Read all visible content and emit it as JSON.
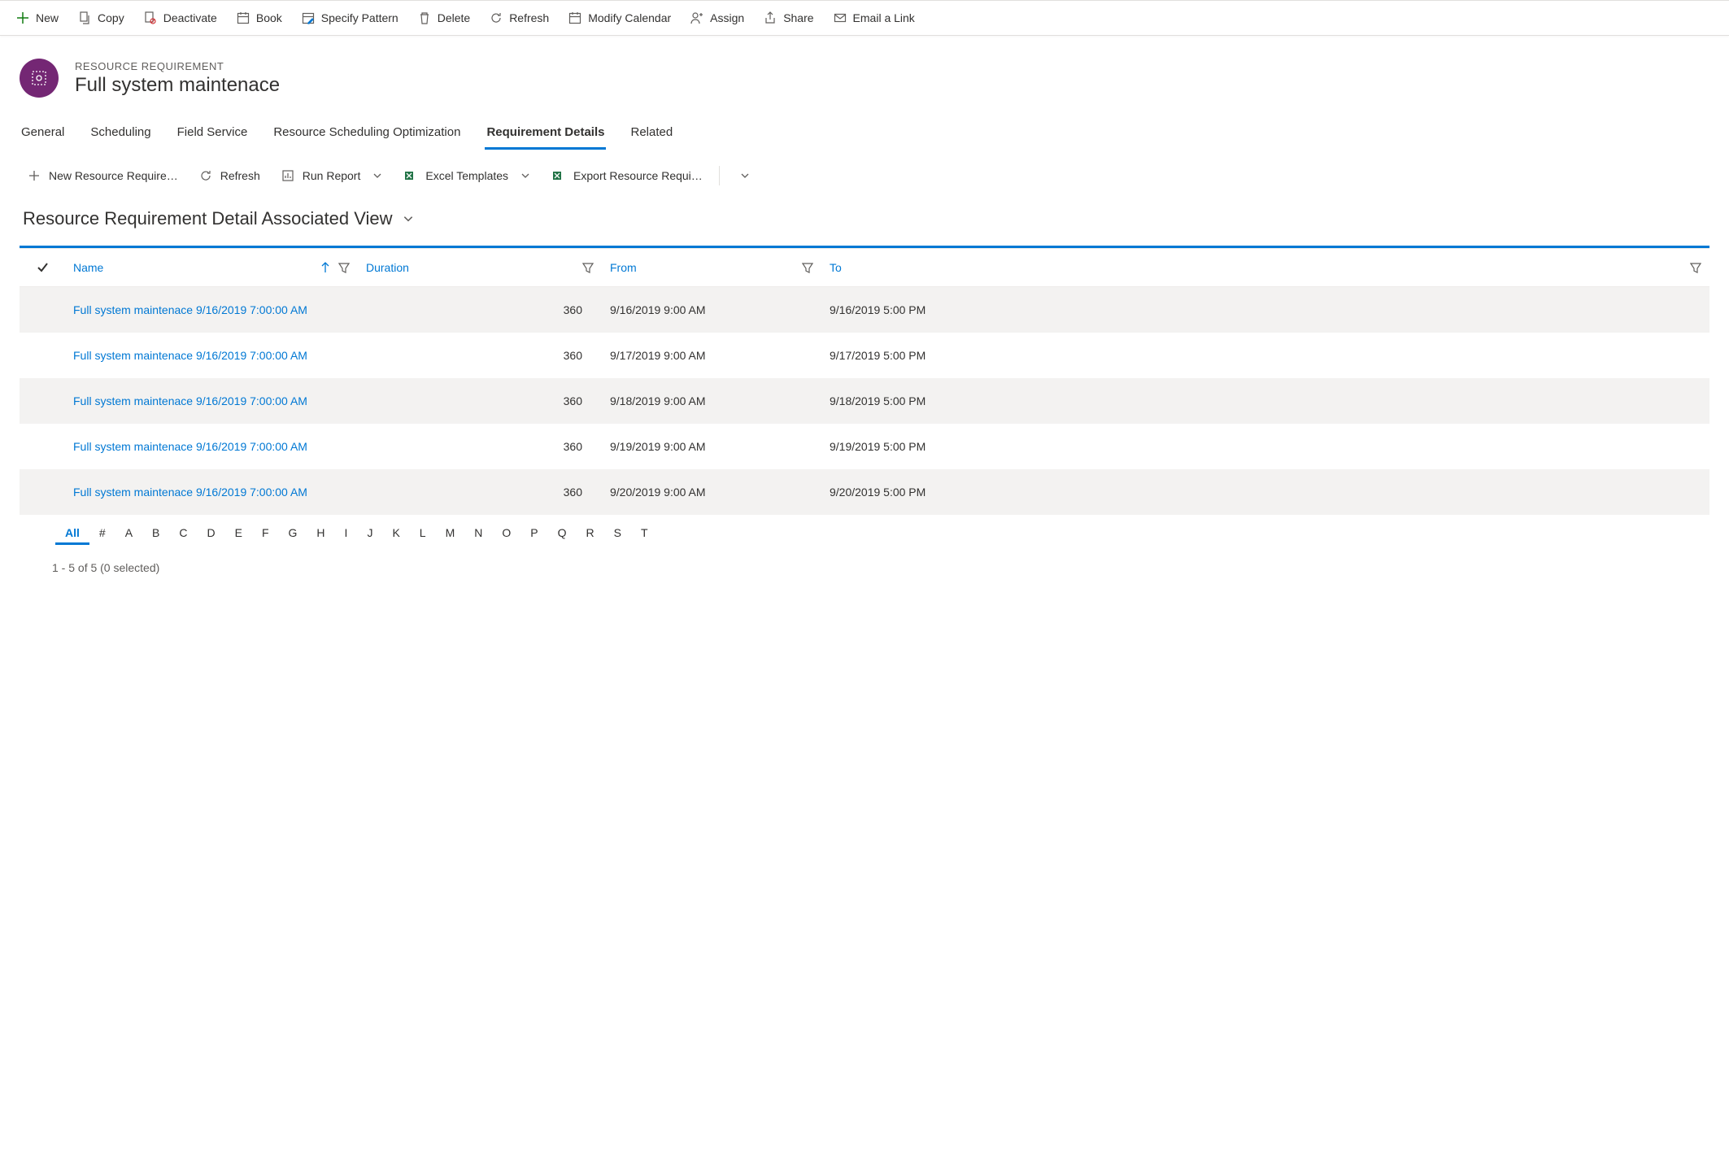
{
  "commandBar": {
    "new": "New",
    "copy": "Copy",
    "deactivate": "Deactivate",
    "book": "Book",
    "specify_pattern": "Specify Pattern",
    "delete": "Delete",
    "refresh": "Refresh",
    "modify_calendar": "Modify Calendar",
    "assign": "Assign",
    "share": "Share",
    "email_link": "Email a Link"
  },
  "header": {
    "eyebrow": "RESOURCE REQUIREMENT",
    "title": "Full system maintenace"
  },
  "tabs": {
    "general": "General",
    "scheduling": "Scheduling",
    "field_service": "Field Service",
    "rso": "Resource Scheduling Optimization",
    "req_details": "Requirement Details",
    "related": "Related"
  },
  "subCommandBar": {
    "new_req": "New Resource Require…",
    "refresh": "Refresh",
    "run_report": "Run Report",
    "excel_templates": "Excel Templates",
    "export": "Export Resource Requi…"
  },
  "view": {
    "title": "Resource Requirement Detail Associated View"
  },
  "columns": {
    "name": "Name",
    "duration": "Duration",
    "from": "From",
    "to": "To"
  },
  "rows": [
    {
      "name": "Full system maintenace 9/16/2019 7:00:00 AM",
      "duration": "360",
      "from": "9/16/2019 9:00 AM",
      "to": "9/16/2019 5:00 PM"
    },
    {
      "name": "Full system maintenace 9/16/2019 7:00:00 AM",
      "duration": "360",
      "from": "9/17/2019 9:00 AM",
      "to": "9/17/2019 5:00 PM"
    },
    {
      "name": "Full system maintenace 9/16/2019 7:00:00 AM",
      "duration": "360",
      "from": "9/18/2019 9:00 AM",
      "to": "9/18/2019 5:00 PM"
    },
    {
      "name": "Full system maintenace 9/16/2019 7:00:00 AM",
      "duration": "360",
      "from": "9/19/2019 9:00 AM",
      "to": "9/19/2019 5:00 PM"
    },
    {
      "name": "Full system maintenace 9/16/2019 7:00:00 AM",
      "duration": "360",
      "from": "9/20/2019 9:00 AM",
      "to": "9/20/2019 5:00 PM"
    }
  ],
  "alphaStrip": [
    "All",
    "#",
    "A",
    "B",
    "C",
    "D",
    "E",
    "F",
    "G",
    "H",
    "I",
    "J",
    "K",
    "L",
    "M",
    "N",
    "O",
    "P",
    "Q",
    "R",
    "S",
    "T"
  ],
  "status": "1 - 5 of 5 (0 selected)"
}
